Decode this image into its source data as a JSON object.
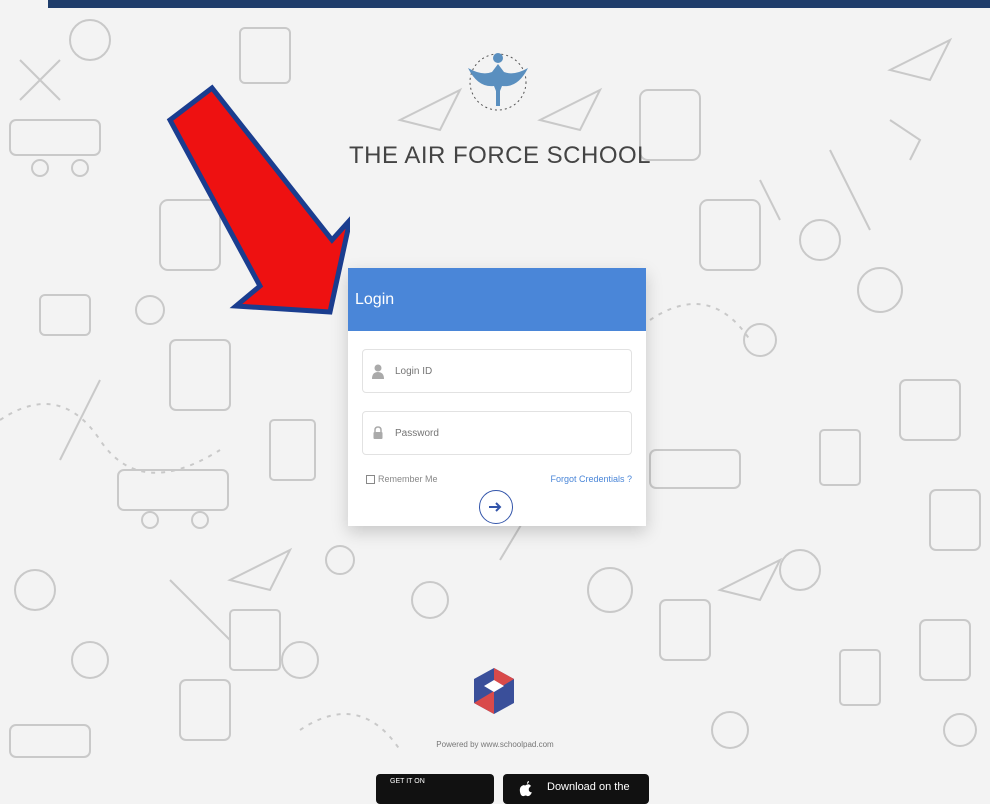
{
  "school": {
    "name": "THE AIR FORCE SCHOOL"
  },
  "login": {
    "title": "Login",
    "login_id_placeholder": "Login ID",
    "password_placeholder": "Password",
    "remember_label": "Remember Me",
    "forgot_label": "Forgot Credentials ?"
  },
  "footer": {
    "powered_text": "Powered by www.schoolpad.com",
    "google_small": "GET IT ON",
    "apple_big": "Download on the"
  },
  "colors": {
    "header_blue": "#4a86d8",
    "arrow_red": "#ee1111",
    "arrow_outline": "#1a3d8f",
    "top_strip": "#1f3d6b"
  },
  "icons": {
    "user": "user-icon",
    "lock": "lock-icon",
    "submit": "arrow-right-icon",
    "apple": "apple-icon"
  }
}
